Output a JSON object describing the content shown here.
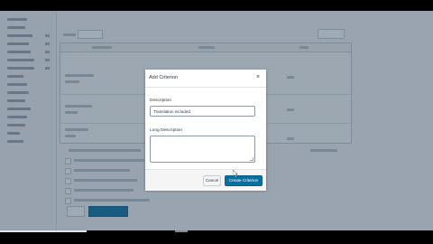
{
  "modal": {
    "title": "Add Criterion",
    "close_glyph": "×",
    "description_label": "Description",
    "description_value": "Translation included",
    "long_description_label": "Long Description",
    "long_description_value": "",
    "cancel_label": "Cancel",
    "create_label": "Create Criterion"
  },
  "colors": {
    "primary_button": "#0770a3",
    "overlay": "#2c4258"
  },
  "video": {
    "progress_fraction": 0.2
  }
}
